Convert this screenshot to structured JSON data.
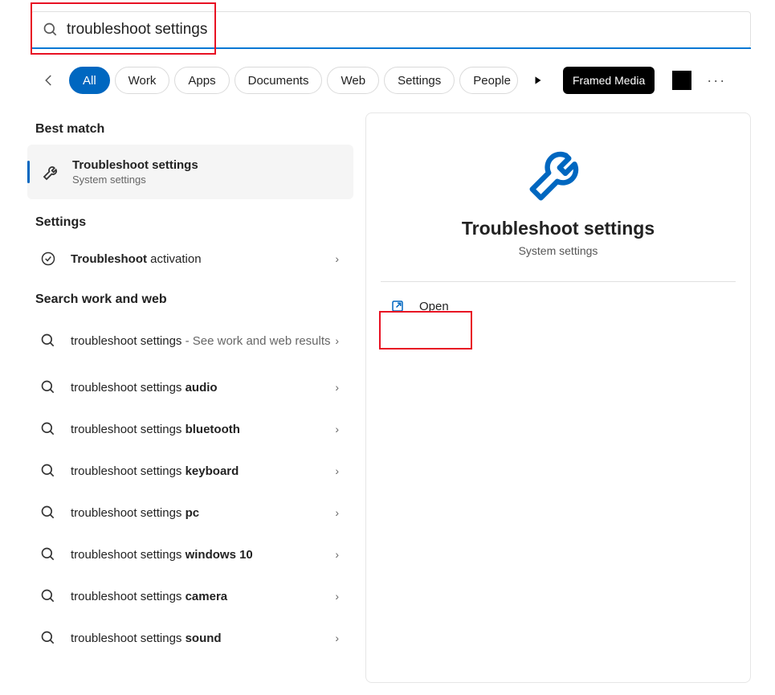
{
  "search": {
    "query": "troubleshoot settings"
  },
  "tabs": {
    "all": "All",
    "work": "Work",
    "apps": "Apps",
    "documents": "Documents",
    "web": "Web",
    "settings": "Settings",
    "people": "People",
    "framed_media": "Framed Media"
  },
  "sections": {
    "best_match": "Best match",
    "settings": "Settings",
    "search_work_web": "Search work and web"
  },
  "best_match": {
    "title": "Troubleshoot settings",
    "subtitle": "System settings"
  },
  "settings_results": [
    {
      "prefix_bold": "Troubleshoot",
      "suffix": " activation"
    }
  ],
  "web_results": [
    {
      "prefix": "troubleshoot settings",
      "sub": " - See work and web results",
      "tall": true
    },
    {
      "prefix": "troubleshoot settings ",
      "bold": "audio"
    },
    {
      "prefix": "troubleshoot settings ",
      "bold": "bluetooth"
    },
    {
      "prefix": "troubleshoot settings ",
      "bold": "keyboard"
    },
    {
      "prefix": "troubleshoot settings ",
      "bold": "pc"
    },
    {
      "prefix": "troubleshoot settings ",
      "bold": "windows 10"
    },
    {
      "prefix": "troubleshoot settings ",
      "bold": "camera"
    },
    {
      "prefix": "troubleshoot settings ",
      "bold": "sound"
    }
  ],
  "detail": {
    "title": "Troubleshoot settings",
    "subtitle": "System settings",
    "open": "Open"
  }
}
